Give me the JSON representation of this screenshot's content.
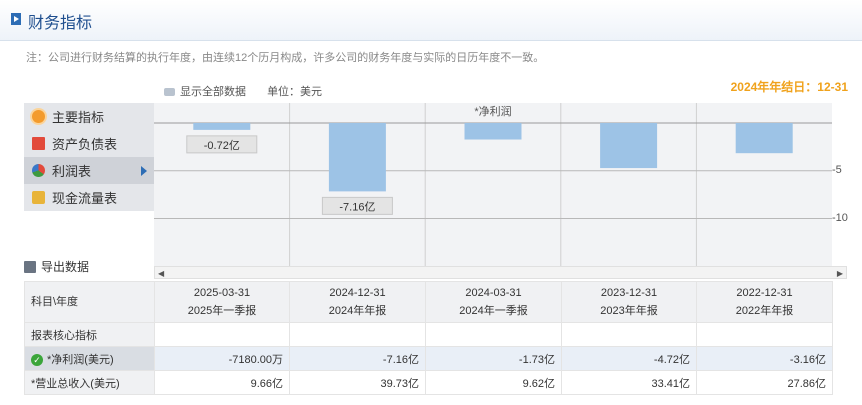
{
  "header": {
    "title": "财务指标"
  },
  "note": "注：公司进行财务结算的执行年度，由连续12个历月构成，许多公司的财务年度与实际的日历年度不一致。",
  "toolbar": {
    "show_all": "显示全部数据",
    "unit": "单位：美元"
  },
  "year_end": "2024年年结日：12-31",
  "menu": [
    {
      "label": "主要指标",
      "icon": "sun-icon"
    },
    {
      "label": "资产负债表",
      "icon": "document-icon"
    },
    {
      "label": "利润表",
      "icon": "pie-chart-icon",
      "active": true
    },
    {
      "label": "现金流量表",
      "icon": "cash-icon"
    }
  ],
  "export_label": "导出数据",
  "chart_data": {
    "type": "bar",
    "title": "*净利润",
    "categories": [
      "2025-03-31",
      "2024-12-31",
      "2024-03-31",
      "2023-12-31",
      "2022-12-31"
    ],
    "series": [
      {
        "values": [
          -0.72,
          -7.16,
          -1.73,
          -4.72,
          -3.16
        ]
      }
    ],
    "data_labels": [
      "-0.72亿",
      "-7.16亿",
      "",
      "",
      ""
    ],
    "yticks": [
      "-5",
      "-10"
    ],
    "ylim": [
      -12.5,
      0.6
    ],
    "unit": "亿",
    "grid": true,
    "colors": {
      "bar": "#9dc3e6",
      "label_bg": "#e4e4e4"
    }
  },
  "table": {
    "corner": "科目\\年度",
    "columns": [
      {
        "date": "2025-03-31",
        "period": "2025年一季报"
      },
      {
        "date": "2024-12-31",
        "period": "2024年年报"
      },
      {
        "date": "2024-03-31",
        "period": "2024年一季报"
      },
      {
        "date": "2023-12-31",
        "period": "2023年年报"
      },
      {
        "date": "2022-12-31",
        "period": "2022年年报"
      }
    ],
    "section": "报表核心指标",
    "rows": [
      {
        "label": "*净利润(美元)",
        "values": [
          "-7180.00万",
          "-7.16亿",
          "-1.73亿",
          "-4.72亿",
          "-3.16亿"
        ]
      },
      {
        "label": "*营业总收入(美元)",
        "values": [
          "9.66亿",
          "39.73亿",
          "9.62亿",
          "33.41亿",
          "27.86亿"
        ]
      }
    ]
  }
}
